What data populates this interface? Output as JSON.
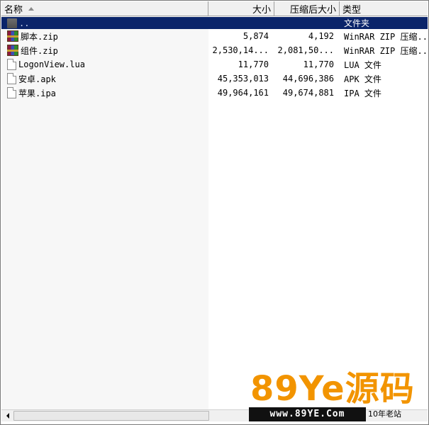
{
  "columns": {
    "name": "名称",
    "size": "大小",
    "compressed_size": "压缩后大小",
    "type": "类型"
  },
  "rows": [
    {
      "name": "..",
      "size": "",
      "compressed_size": "",
      "type": "文件夹",
      "icon": "folder-up-icon",
      "selected": true
    },
    {
      "name": "脚本.zip",
      "size": "5,874",
      "compressed_size": "4,192",
      "type": "WinRAR ZIP 压缩...",
      "icon": "rar-archive-icon"
    },
    {
      "name": "组件.zip",
      "size": "2,530,14...",
      "compressed_size": "2,081,50...",
      "type": "WinRAR ZIP 压缩...",
      "icon": "rar-archive-icon"
    },
    {
      "name": "LogonView.lua",
      "size": "11,770",
      "compressed_size": "11,770",
      "type": "LUA 文件",
      "icon": "file-icon"
    },
    {
      "name": "安卓.apk",
      "size": "45,353,013",
      "compressed_size": "44,696,386",
      "type": "APK 文件",
      "icon": "file-icon"
    },
    {
      "name": "苹果.ipa",
      "size": "49,964,161",
      "compressed_size": "49,674,881",
      "type": "IPA 文件",
      "icon": "file-icon"
    }
  ],
  "watermark": {
    "brand": "89Ye源码",
    "url": "www.89YE.Com",
    "tagline": "10年老站"
  },
  "colors": {
    "selection": "#0a246a",
    "brand": "#f29400"
  }
}
